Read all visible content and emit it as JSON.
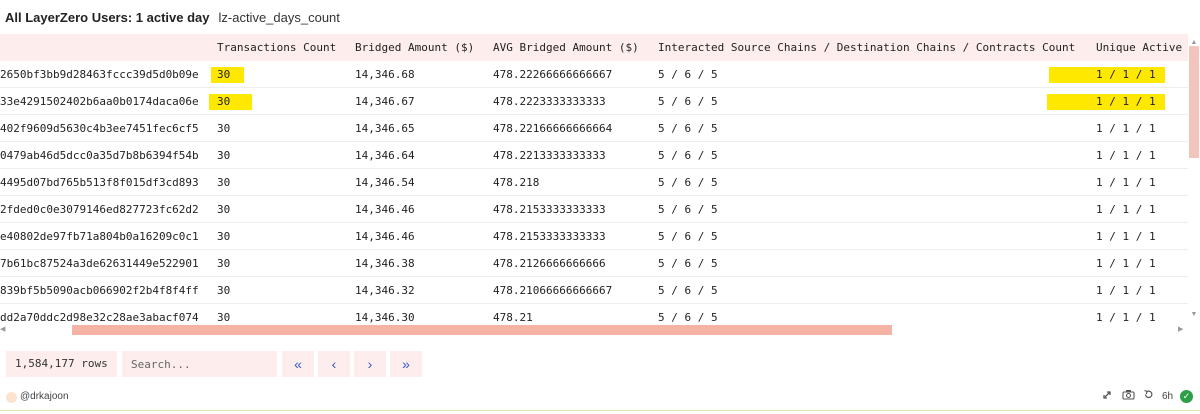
{
  "header": {
    "title": "All LayerZero Users: 1 active day",
    "subtitle": "lz-active_days_count"
  },
  "table": {
    "columns": [
      "Transactions Count",
      "Bridged Amount ($)",
      "AVG Bridged Amount ($)",
      "Interacted Source Chains / Destination Chains / Contracts Count",
      "Unique Active"
    ],
    "rows": [
      {
        "address": "2650bf3bb9d28463fccc39d5d0b09e",
        "tx": "30",
        "bridged": "14,346.68",
        "avg": "478.22266666666667",
        "chains": "5 / 6 / 5",
        "unique": "1 / 1 / 1"
      },
      {
        "address": "33e4291502402b6aa0b0174daca06e",
        "tx": "30",
        "bridged": "14,346.67",
        "avg": "478.2223333333333",
        "chains": "5 / 6 / 5",
        "unique": "1 / 1 / 1"
      },
      {
        "address": "402f9609d5630c4b3ee7451fec6cf5",
        "tx": "30",
        "bridged": "14,346.65",
        "avg": "478.22166666666664",
        "chains": "5 / 6 / 5",
        "unique": "1 / 1 / 1"
      },
      {
        "address": "0479ab46d5dcc0a35d7b8b6394f54b",
        "tx": "30",
        "bridged": "14,346.64",
        "avg": "478.2213333333333",
        "chains": "5 / 6 / 5",
        "unique": "1 / 1 / 1"
      },
      {
        "address": "4495d07bd765b513f8f015df3cd893",
        "tx": "30",
        "bridged": "14,346.54",
        "avg": "478.218",
        "chains": "5 / 6 / 5",
        "unique": "1 / 1 / 1"
      },
      {
        "address": "2fded0c0e3079146ed827723fc62d2",
        "tx": "30",
        "bridged": "14,346.46",
        "avg": "478.2153333333333",
        "chains": "5 / 6 / 5",
        "unique": "1 / 1 / 1"
      },
      {
        "address": "e40802de97fb71a804b0a16209c0c1",
        "tx": "30",
        "bridged": "14,346.46",
        "avg": "478.2153333333333",
        "chains": "5 / 6 / 5",
        "unique": "1 / 1 / 1"
      },
      {
        "address": "7b61bc87524a3de62631449e522901",
        "tx": "30",
        "bridged": "14,346.38",
        "avg": "478.2126666666666",
        "chains": "5 / 6 / 5",
        "unique": "1 / 1 / 1"
      },
      {
        "address": "839bf5b5090acb066902f2b4f8f4ff",
        "tx": "30",
        "bridged": "14,346.32",
        "avg": "478.21066666666667",
        "chains": "5 / 6 / 5",
        "unique": "1 / 1 / 1"
      },
      {
        "address": "dd2a70ddc2d98e32c28ae3abacf074",
        "tx": "30",
        "bridged": "14,346.30",
        "avg": "478.21",
        "chains": "5 / 6 / 5",
        "unique": "1 / 1 / 1"
      }
    ]
  },
  "footer": {
    "rows_count": "1,584,177 rows",
    "search_placeholder": "Search...",
    "first_page_icon": "«",
    "prev_page_icon": "‹",
    "next_page_icon": "›",
    "last_page_icon": "»"
  },
  "bottom": {
    "author": "@drkajoon",
    "refresh_time": "6h"
  },
  "colors": {
    "highlight": "#ffe800",
    "header_bg": "#fdeeed",
    "scroll_thumb": "#f5b3a6",
    "pager_icon": "#3a55c4",
    "status_ok": "#2e9e47"
  }
}
